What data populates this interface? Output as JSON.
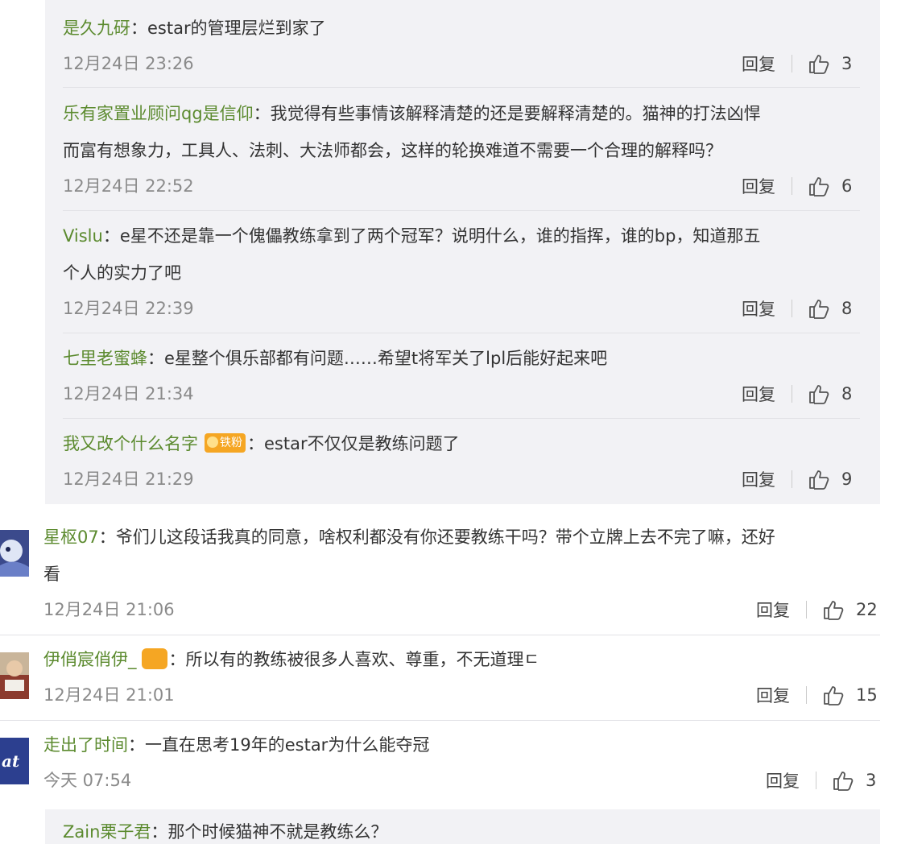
{
  "replies": [
    {
      "user": "是久九砑",
      "text": "estar的管理层烂到家了",
      "text2": "",
      "time": "12月24日 23:26",
      "likes": "3"
    },
    {
      "user": "乐有家置业顾问qg是信仰",
      "text": "我觉得有些事情该解释清楚的还是要解释清楚的。猫神的打法凶悍",
      "text2": "而富有想象力，工具人、法刺、大法师都会，这样的轮换难道不需要一个合理的解释吗？",
      "time": "12月24日 22:52",
      "likes": "6"
    },
    {
      "user": "Vislu",
      "text": "e星不还是靠一个傀儡教练拿到了两个冠军？说明什么，谁的指挥，谁的bp，知道那五",
      "text2": "个人的实力了吧",
      "time": "12月24日 22:39",
      "likes": "8"
    },
    {
      "user": "七里老蜜蜂",
      "text": "e星整个俱乐部都有问题……希望t将军关了lpl后能好起来吧",
      "text2": "",
      "time": "12月24日 21:34",
      "likes": "8"
    },
    {
      "user": "我又改个什么名字",
      "badge": "铁粉",
      "text": "estar不仅仅是教练问题了",
      "text2": "",
      "time": "12月24日 21:29",
      "likes": "9"
    }
  ],
  "comments": [
    {
      "user": "星枢07",
      "text": "爷们儿这段话我真的同意，啥权利都没有你还要教练干吗？带个立牌上去不完了嘛，还好",
      "text2": "看",
      "time": "12月24日 21:06",
      "likes": "22"
    },
    {
      "user": "伊俏宸俏伊_",
      "text": "所以有的教练被很多人喜欢、尊重，不无道理ㄷ",
      "text2": "",
      "time": "12月24日 21:01",
      "likes": "15"
    },
    {
      "user": "走出了时间",
      "text": "一直在思考19年的estar为什么能夺冠",
      "text2": "",
      "time": "今天 07:54",
      "likes": "3"
    }
  ],
  "last_reply": {
    "user": "Zain栗子君",
    "text": "那个时候猫神不就是教练么？"
  },
  "labels": {
    "reply": "回复",
    "separator": "："
  },
  "icons": {
    "like": "thumb-up-icon"
  },
  "colors": {
    "username": "#5b8a2e",
    "background_nested": "#f2f2f5",
    "badge": "#f5a623"
  }
}
